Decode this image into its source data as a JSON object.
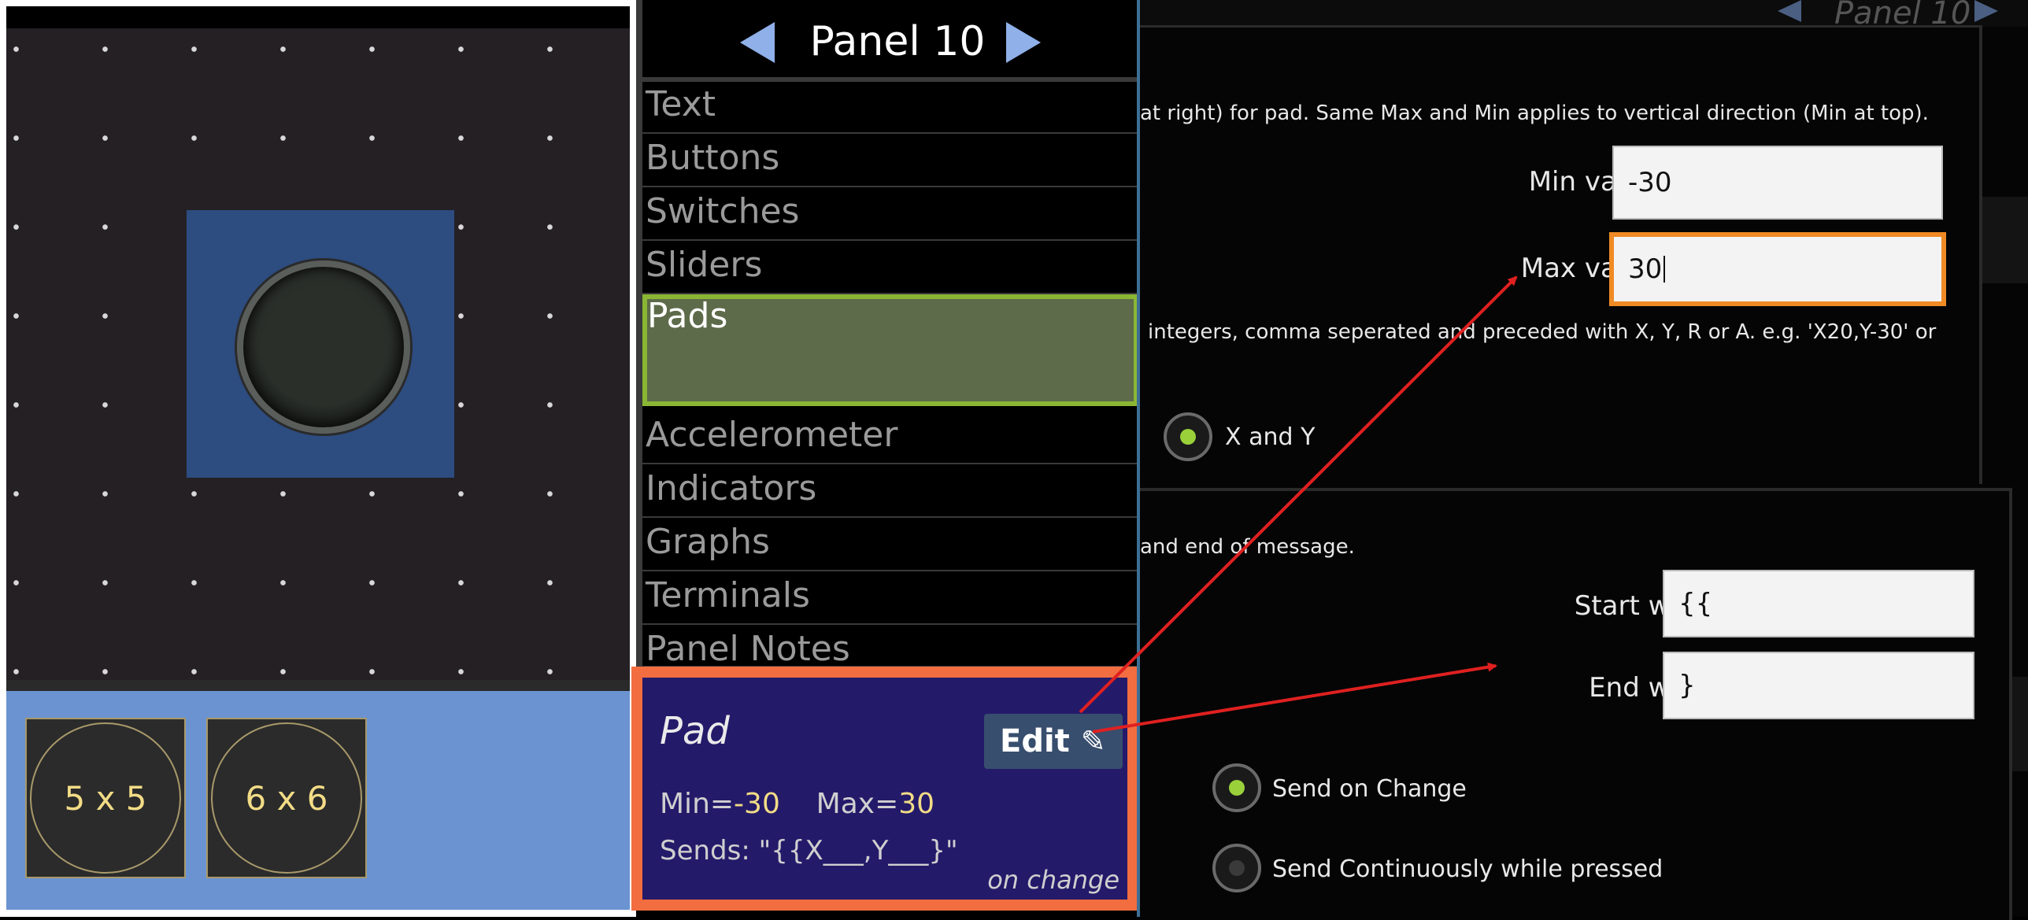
{
  "canvas": {
    "size_options": [
      "5 x 5",
      "6 x 6"
    ]
  },
  "menu": {
    "panel_title": "Panel 10",
    "items": [
      "Text",
      "Buttons",
      "Switches",
      "Sliders",
      "Pads",
      "Accelerometer",
      "Indicators",
      "Graphs",
      "Terminals",
      "Panel Notes"
    ],
    "selected": "Pads"
  },
  "pad_info": {
    "title": "Pad",
    "edit_label": "Edit",
    "min_label": "Min=",
    "min_value": "-30",
    "max_label": "Max=",
    "max_value": "30",
    "sends": "Sends: \"{{X___,Y___}\"",
    "mode": "on change"
  },
  "background_header": {
    "panel_title": "Panel 10"
  },
  "dialog_range": {
    "description": "at right) for pad.  Same Max and Min applies to vertical direction (Min at top).",
    "min_label": "Min value :",
    "min_value": "-30",
    "max_label": "Max value :",
    "max_value": "30",
    "format_note": "integers, comma seperated and preceded with X, Y, R or A. e.g. 'X20,Y-30' or",
    "axis_option": "X and Y"
  },
  "dialog_message": {
    "description": "and end of message.",
    "start_label": "Start with :",
    "start_value": "{{",
    "end_label": "End with :",
    "end_value": "}",
    "send_on_change": "Send on Change",
    "send_continuously": "Send Continuously while pressed"
  },
  "colors": {
    "menu_selected_border": "#8ab634",
    "pad_info_border": "#f26d3f",
    "focused_field_border": "#f08a24",
    "arrow": "#e02020",
    "nav_arrow": "#8fb0e8",
    "radio_on": "#9ad03a"
  }
}
